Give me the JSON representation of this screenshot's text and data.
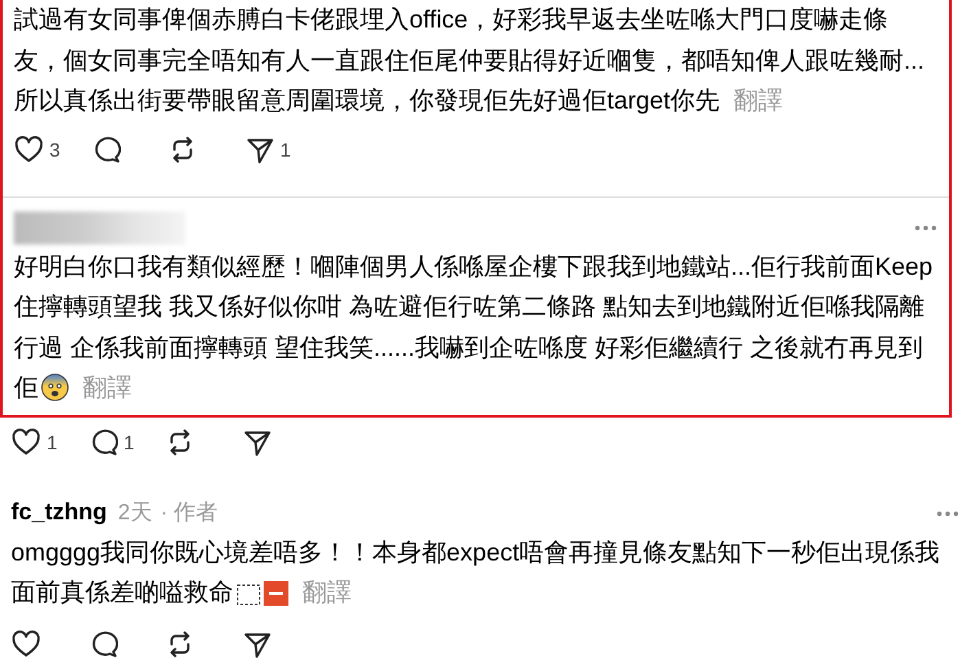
{
  "posts": [
    {
      "highlighted": true,
      "body": [
        {
          "kind": "text",
          "text": "試過有女同事俾個赤膊白卡佬跟埋入office，好彩我早返去坐咗喺大門口度嚇走條友，個女同事完全唔知有人一直跟住佢尾仲要貼得好近嗰隻，都唔知俾人跟咗幾耐...所以真係出街要帶眼留意周圍環境，你發現佢先好過佢target你先"
        }
      ],
      "translate": "翻譯",
      "actions": [
        {
          "kind": "like",
          "count": "3"
        },
        {
          "kind": "reply"
        },
        {
          "kind": "repost"
        },
        {
          "kind": "share",
          "count": "1"
        }
      ]
    },
    {
      "highlighted": true,
      "author": {
        "redacted": true
      },
      "body": [
        {
          "kind": "text",
          "text": "好明白你口我有類似經歷！嗰陣個男人係喺屋企樓下跟我到地鐵站...佢行我前面Keep住擰轉頭望我 我又係好似你咁 為咗避佢行咗第二條路 點知去到地鐵附近佢喺我隔離行過 企係我前面擰轉頭 望住我笑......我嚇到企咗喺度 好彩佢繼續行 之後就冇再見到佢"
        },
        {
          "kind": "fearful"
        }
      ],
      "translate": "翻譯",
      "actions": [
        {
          "kind": "like",
          "count": "1"
        },
        {
          "kind": "reply",
          "count": "1"
        },
        {
          "kind": "repost"
        },
        {
          "kind": "share"
        }
      ]
    },
    {
      "highlighted": false,
      "author": {
        "redacted": false,
        "name": "fc_tzhng",
        "time": "2天",
        "role": "· 作者"
      },
      "body": [
        {
          "kind": "text",
          "text": "omgggg我同你既心境差唔多！！本身都expect唔會再撞見條友點知下一秒佢出現係我面前真係差啲嗌救命"
        },
        {
          "kind": "object"
        },
        {
          "kind": "sos"
        }
      ],
      "translate": "翻譯",
      "actions": [
        {
          "kind": "like"
        },
        {
          "kind": "reply"
        },
        {
          "kind": "repost"
        },
        {
          "kind": "share"
        }
      ]
    }
  ]
}
